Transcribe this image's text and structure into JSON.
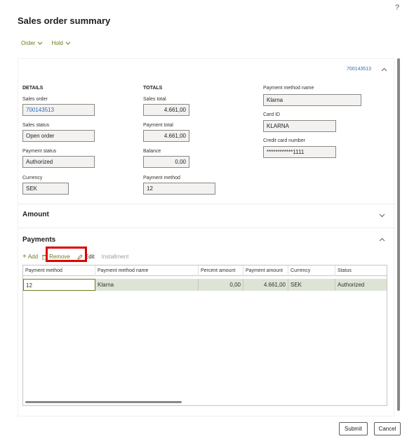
{
  "help_label": "?",
  "title": "Sales order summary",
  "menu": [
    {
      "label": "Order"
    },
    {
      "label": "Hold"
    }
  ],
  "header_link": "700143513",
  "details": {
    "heading": "DETAILS",
    "sales_order_label": "Sales order",
    "sales_order_value": "700143513",
    "sales_status_label": "Sales status",
    "sales_status_value": "Open order",
    "payment_status_label": "Payment status",
    "payment_status_value": "Authorized",
    "currency_label": "Currency",
    "currency_value": "SEK"
  },
  "totals": {
    "heading": "TOTALS",
    "sales_total_label": "Sales total",
    "sales_total_value": "4.661,00",
    "payment_total_label": "Payment total",
    "payment_total_value": "4.661,00",
    "balance_label": "Balance",
    "balance_value": "0,00",
    "payment_method_label": "Payment method",
    "payment_method_value": "12"
  },
  "payment_info": {
    "method_name_label": "Payment method name",
    "method_name_value": "Klarna",
    "card_id_label": "Card ID",
    "card_id_value": "KLARNA",
    "card_number_label": "Credit card number",
    "card_number_value": "************1111"
  },
  "amount_section": {
    "title": "Amount"
  },
  "payments_section": {
    "title": "Payments"
  },
  "toolbar": {
    "add": "Add",
    "remove": "Remove",
    "edit": "Edit",
    "installment": "Installment"
  },
  "grid": {
    "columns": [
      "Payment method",
      "Payment method name",
      "Percent amount",
      "Payment amount",
      "Currency",
      "Status"
    ],
    "rows": [
      [
        "12",
        "Klarna",
        "0,00",
        "4.661,00",
        "SEK",
        "Authorized"
      ]
    ]
  },
  "buttons": {
    "submit": "Submit",
    "cancel": "Cancel"
  },
  "colors": {
    "accent_green": "#6b7d1f",
    "link_blue": "#2e6db5",
    "highlight_red": "#e00000",
    "selected_row": "#dde4d6"
  }
}
